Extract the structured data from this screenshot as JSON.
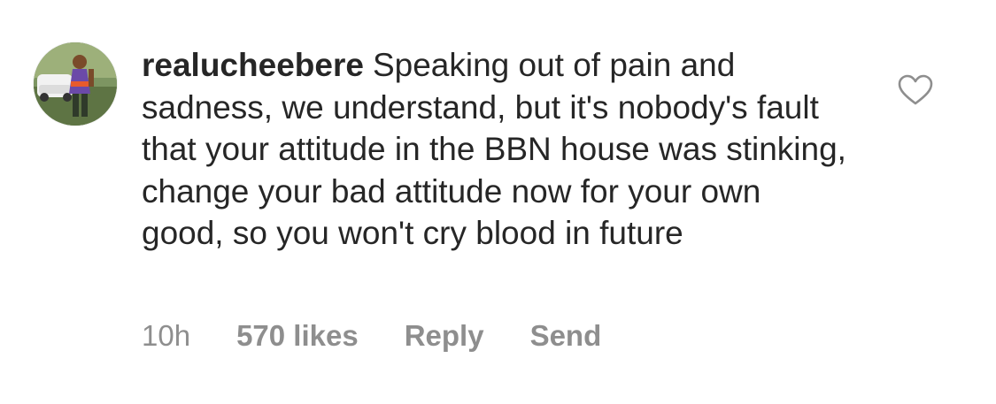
{
  "comment": {
    "username": "realucheebere",
    "text": "Speaking out of pain and sadness, we understand, but it's nobody's fault that your attitude in the BBN house was stinking, change your bad attitude now for your own good, so you won't cry blood in future",
    "avatar_icon": "profile-photo",
    "like_icon": "heart-outline-icon"
  },
  "meta": {
    "timestamp": "10h",
    "likes": "570 likes",
    "reply_label": "Reply",
    "send_label": "Send"
  },
  "colors": {
    "text": "#262626",
    "secondary": "#8e8e8e",
    "background": "#ffffff"
  }
}
